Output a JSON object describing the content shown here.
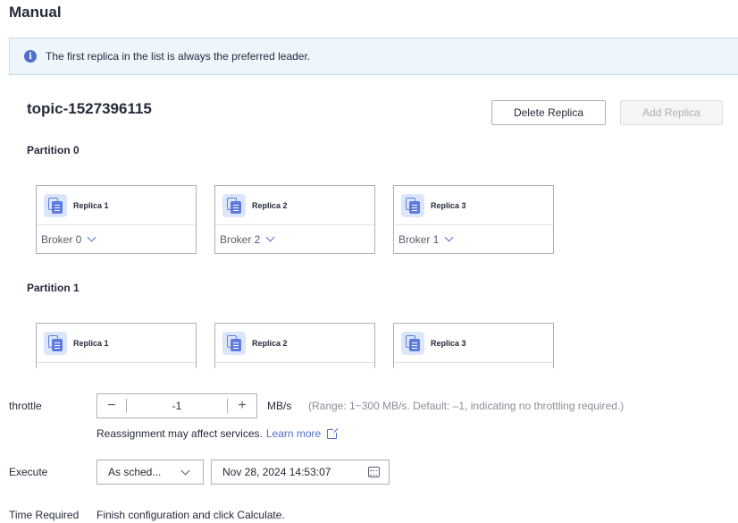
{
  "page": {
    "title": "Manual"
  },
  "info": {
    "text": "The first replica in the list is always the preferred leader.",
    "icon": "info-icon"
  },
  "topic": {
    "name": "topic-1527396115",
    "delete_label": "Delete Replica",
    "add_label": "Add Replica"
  },
  "partitions": [
    {
      "label": "Partition 0",
      "replicas": [
        {
          "title": "Replica 1",
          "broker": "Broker 0"
        },
        {
          "title": "Replica 2",
          "broker": "Broker 2"
        },
        {
          "title": "Replica 3",
          "broker": "Broker 1"
        }
      ]
    },
    {
      "label": "Partition 1",
      "replicas": [
        {
          "title": "Replica 1"
        },
        {
          "title": "Replica 2"
        },
        {
          "title": "Replica 3"
        }
      ]
    }
  ],
  "throttle": {
    "label": "throttle",
    "minus": "−",
    "value": "-1",
    "plus": "+",
    "unit": "MB/s",
    "hint": "(Range: 1~300 MB/s. Default: –1, indicating no throttling required.)",
    "warning": "Reassignment may affect services.",
    "learn_more": "Learn more"
  },
  "execute": {
    "label": "Execute",
    "mode_value": "As sched...",
    "datetime": "Nov 28, 2024 14:53:07"
  },
  "time_required": {
    "label": "Time Required",
    "value": "Finish configuration and click Calculate."
  },
  "colors": {
    "accent": "#526ecc",
    "info_bg": "#edf6fd",
    "border": "#adb0b8",
    "text": "#252b3a"
  }
}
